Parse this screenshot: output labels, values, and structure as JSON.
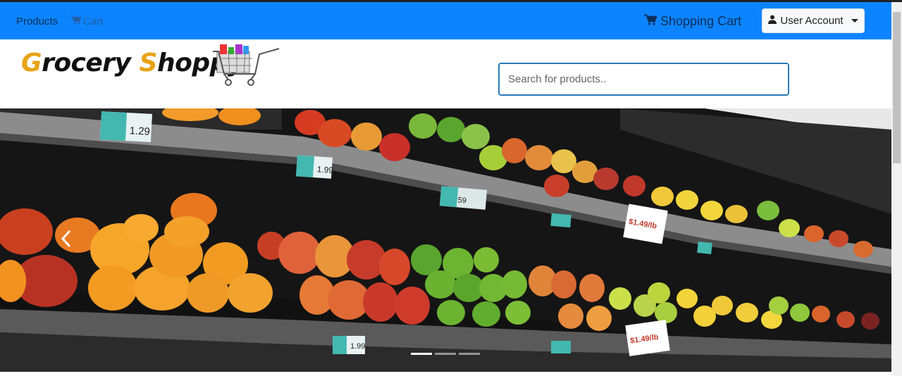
{
  "navbar": {
    "products_label": "Products",
    "cart_label": "Cart",
    "shopping_cart_label": "Shopping Cart",
    "user_account_label": "User Account"
  },
  "header": {
    "logo_initial_1": "G",
    "logo_rest_1": "rocery ",
    "logo_initial_2": "S",
    "logo_rest_2": "hoppy"
  },
  "search": {
    "placeholder": "Search for products.."
  },
  "banner": {
    "price_tags": [
      "1.29",
      "1.99",
      "59",
      "1.99",
      "$1.49/lb",
      "$1.49/lb"
    ]
  },
  "colors": {
    "navbar": "#0d84ff",
    "logo_accent": "#e8a317",
    "search_border": "#2a7ab8"
  }
}
